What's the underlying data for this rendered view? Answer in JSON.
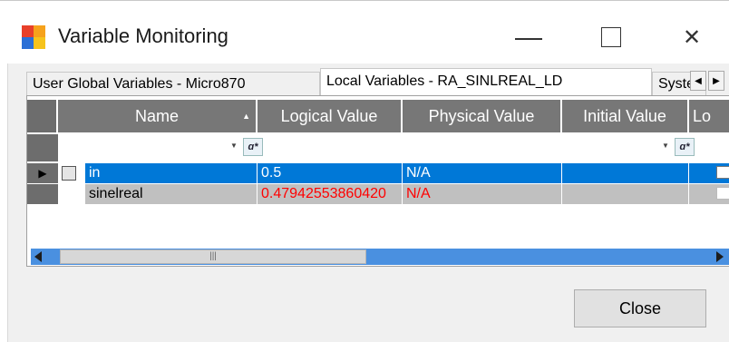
{
  "window": {
    "title": "Variable Monitoring",
    "controls": {
      "minimize": "minimize",
      "maximize": "maximize",
      "close": "close"
    }
  },
  "tabs": [
    {
      "label": "User Global Variables - Micro870",
      "active": false
    },
    {
      "label": "Local Variables - RA_SINLREAL_LD",
      "active": true
    },
    {
      "label": "System Variables",
      "active": false
    }
  ],
  "grid": {
    "columns": [
      "Name",
      "Logical Value",
      "Physical Value",
      "Initial Value",
      "Lo"
    ],
    "filter_icon": "filter-icon",
    "rows": [
      {
        "name": "in",
        "logical": "0.5",
        "physical": "N/A",
        "initial": "",
        "selected": true
      },
      {
        "name": "sinelreal",
        "logical": "0.47942553860420",
        "physical": "N/A",
        "initial": "",
        "selected": false
      }
    ]
  },
  "buttons": {
    "close": "Close"
  },
  "colors": {
    "header_bg": "#777777",
    "selected_row": "#0078d7",
    "alt_row": "#c0c0c0",
    "error_text": "#ff0000"
  }
}
